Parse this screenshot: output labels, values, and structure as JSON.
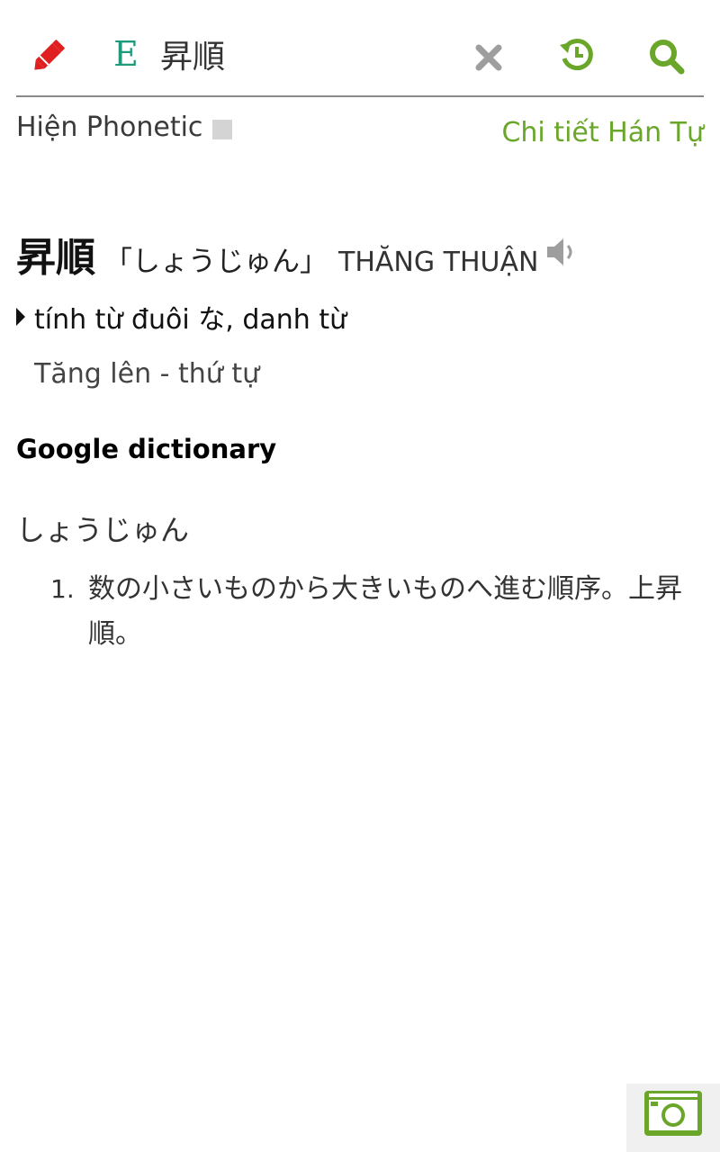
{
  "search": {
    "query": "昇順",
    "language_badge": "E",
    "icons": {
      "edit": "pencil-icon",
      "clear": "close-icon",
      "history": "history-icon",
      "search": "search-icon"
    }
  },
  "options": {
    "phonetic_label": "Hiện Phonetic",
    "phonetic_checked": false,
    "kanji_detail_link": "Chi tiết Hán Tự"
  },
  "entry": {
    "word": "昇順",
    "reading": "「しょうじゅん」",
    "hanviet": "THĂNG THUẬN",
    "part_of_speech": "tính từ đuôi な, danh từ",
    "meaning": "Tăng lên - thứ tự"
  },
  "google_dictionary": {
    "title": "Google dictionary",
    "reading": "しょうじゅん",
    "definitions": [
      {
        "number": "1.",
        "text": "数の小さいものから大きいものへ進む順序。上昇順。"
      }
    ]
  },
  "colors": {
    "accent_green": "#6aa629",
    "pencil_red": "#e02020",
    "badge_teal": "#1c9a7a",
    "icon_gray": "#9e9e9e"
  }
}
